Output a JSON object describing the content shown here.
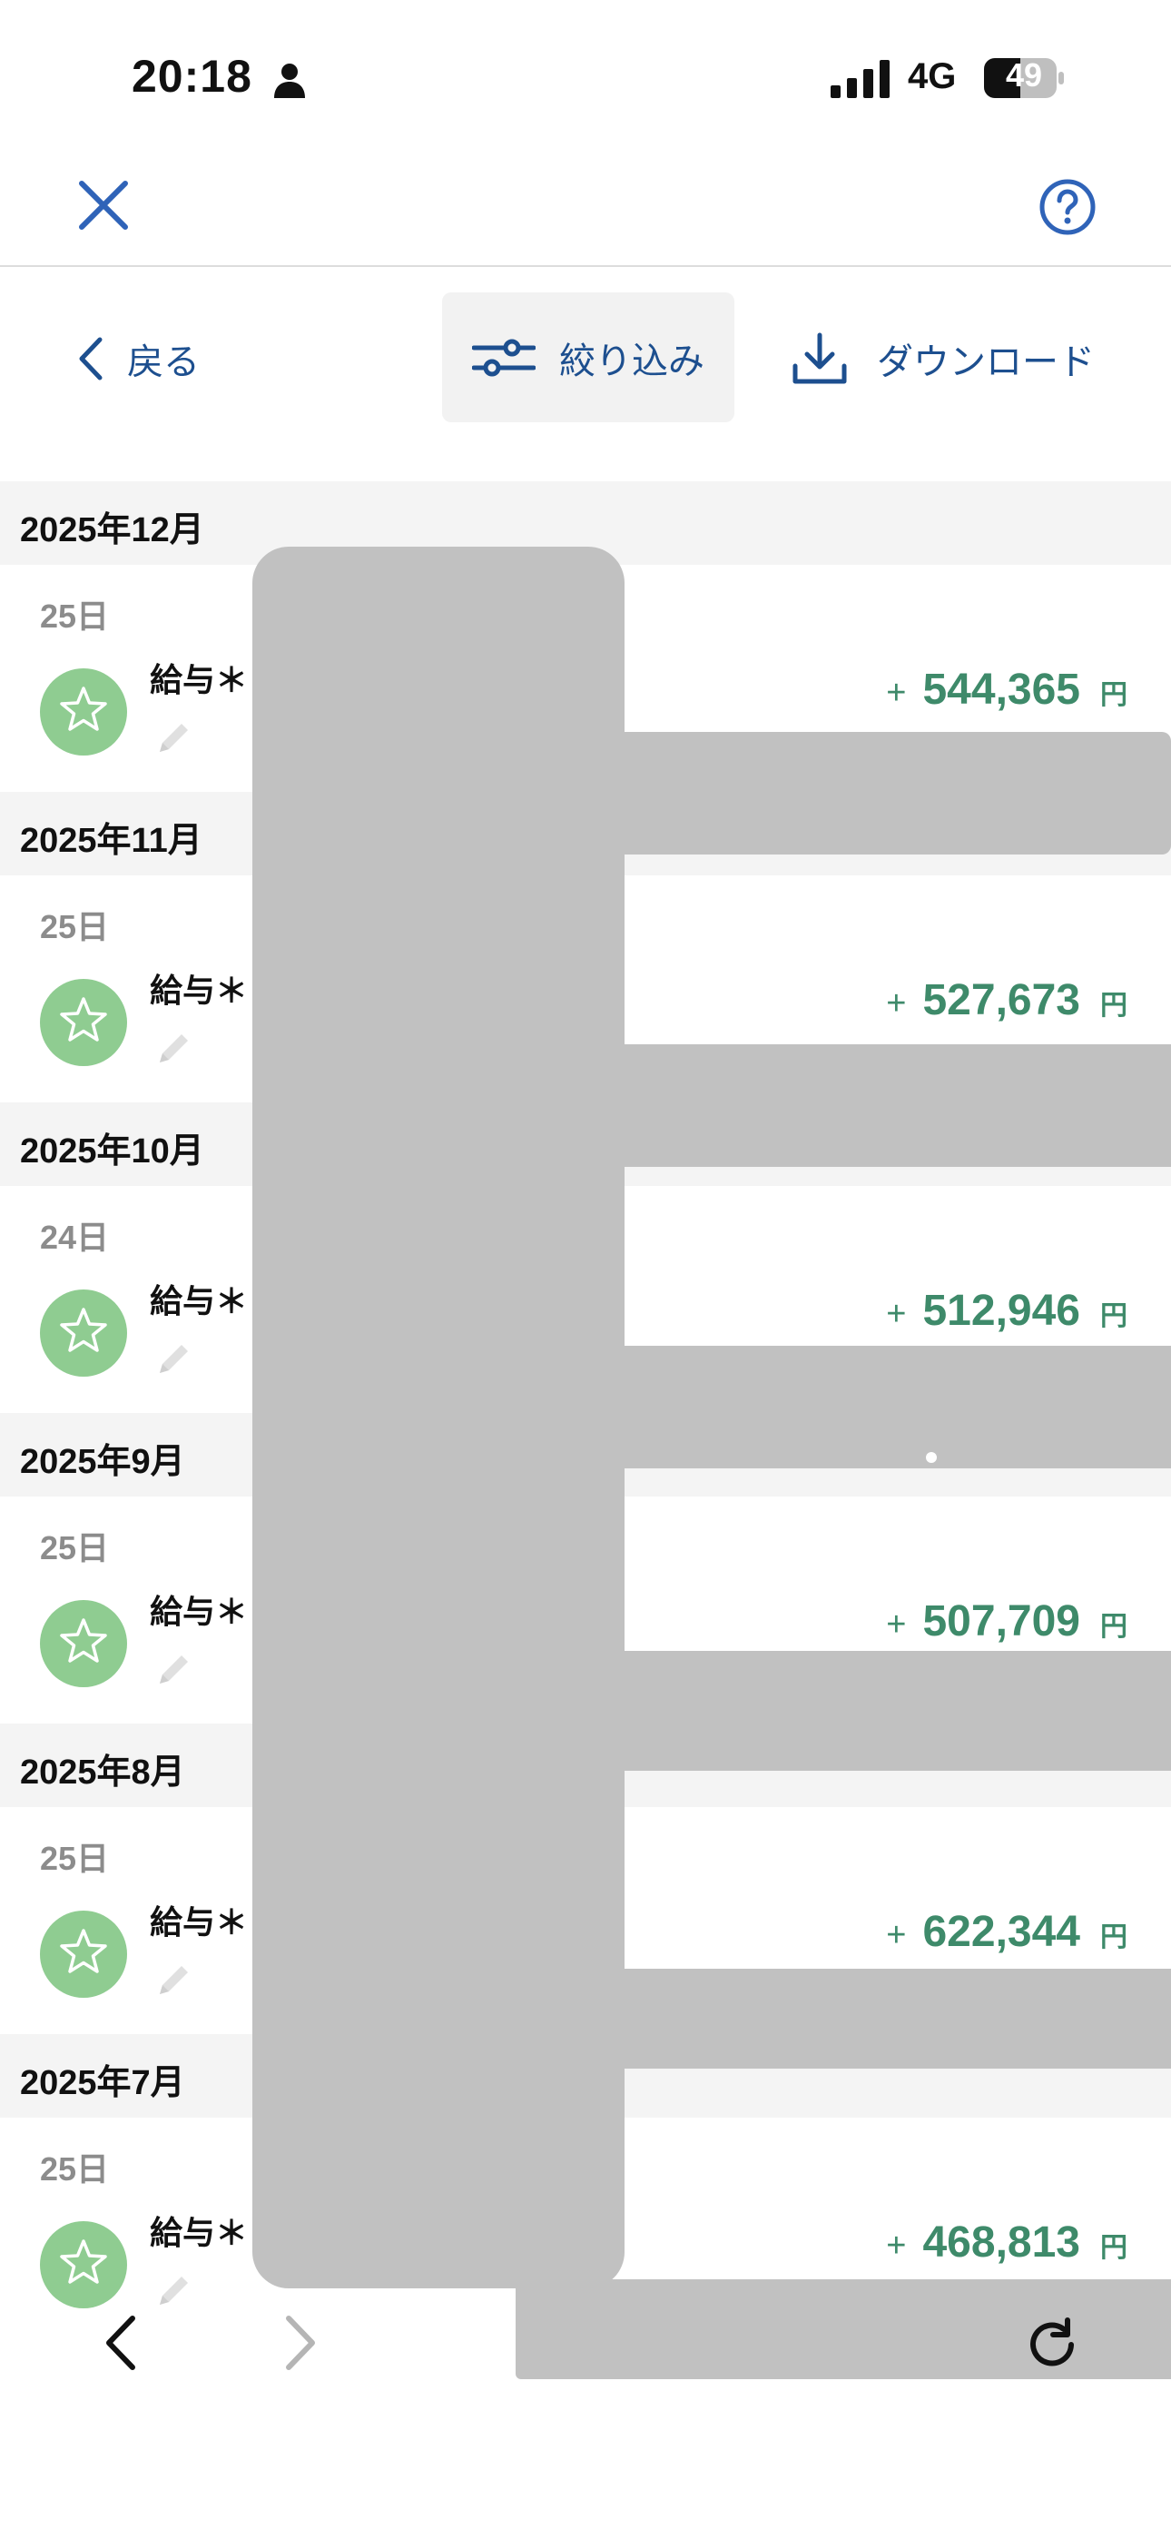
{
  "status_bar": {
    "time": "20:18",
    "network": "4G",
    "battery": "49"
  },
  "toolbar": {
    "back_label": "戻る",
    "filter_label": "絞り込み",
    "download_label": "ダウンロード"
  },
  "colors": {
    "accent_blue": "#1d4f8f",
    "amount_green": "#3e8a6a",
    "badge_green": "#8fcc91"
  },
  "entries": [
    {
      "month": "2025年12月",
      "day": "25日",
      "description": "給与＊",
      "sign": "+",
      "amount": "544,365",
      "unit": "円"
    },
    {
      "month": "2025年11月",
      "day": "25日",
      "description": "給与＊",
      "sign": "+",
      "amount": "527,673",
      "unit": "円"
    },
    {
      "month": "2025年10月",
      "day": "24日",
      "description": "給与＊",
      "sign": "+",
      "amount": "512,946",
      "unit": "円"
    },
    {
      "month": "2025年9月",
      "day": "25日",
      "description": "給与＊",
      "sign": "+",
      "amount": "507,709",
      "unit": "円"
    },
    {
      "month": "2025年8月",
      "day": "25日",
      "description": "給与＊",
      "sign": "+",
      "amount": "622,344",
      "unit": "円"
    },
    {
      "month": "2025年7月",
      "day": "25日",
      "description": "給与＊",
      "sign": "+",
      "amount": "468,813",
      "unit": "円"
    }
  ]
}
